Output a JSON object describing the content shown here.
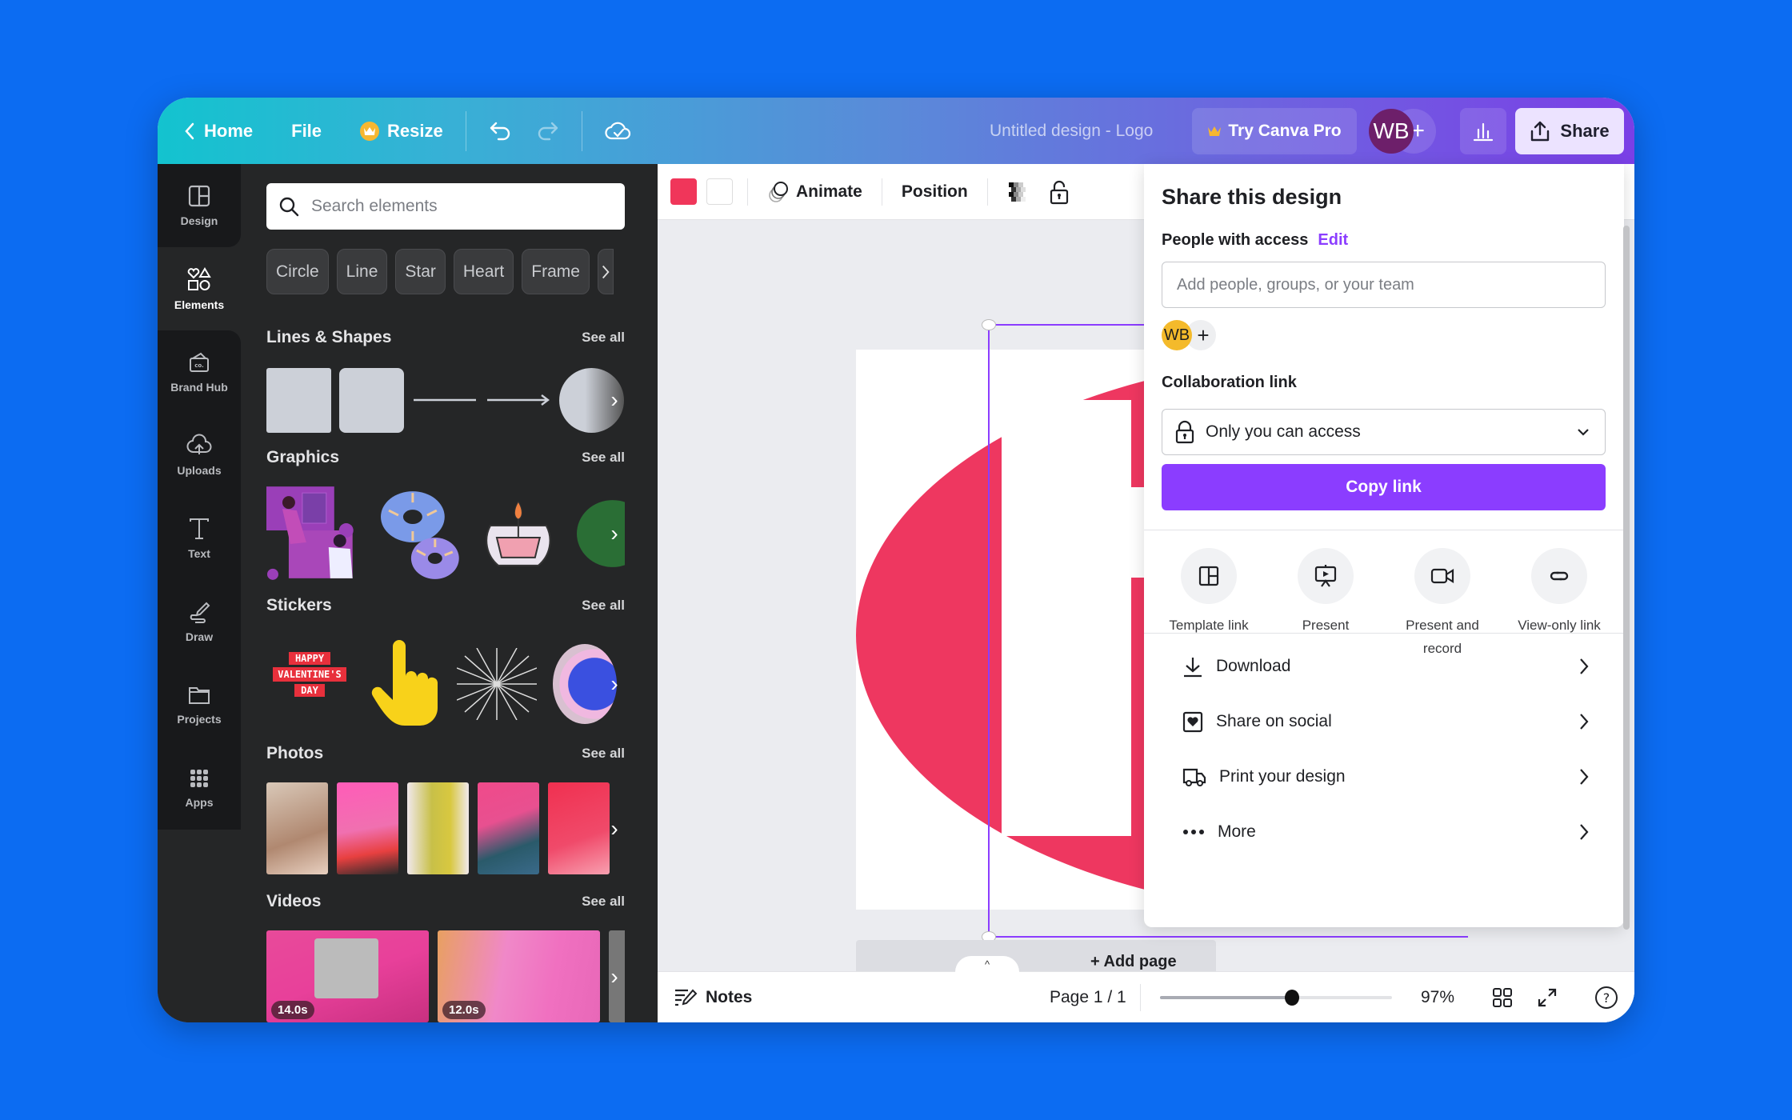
{
  "topbar": {
    "home_label": "Home",
    "file_label": "File",
    "resize_label": "Resize",
    "document_title": "Untitled design - Logo",
    "try_pro_label": "Try Canva Pro",
    "user_initials": "WB",
    "add_collaborator": "+",
    "share_label": "Share"
  },
  "rail": {
    "items": [
      {
        "label": "Design",
        "icon": "layout-icon"
      },
      {
        "label": "Elements",
        "icon": "shapes-icon",
        "active": true
      },
      {
        "label": "Brand Hub",
        "icon": "brand-hub-icon"
      },
      {
        "label": "Uploads",
        "icon": "cloud-upload-icon"
      },
      {
        "label": "Text",
        "icon": "text-icon"
      },
      {
        "label": "Draw",
        "icon": "draw-icon"
      },
      {
        "label": "Projects",
        "icon": "folder-icon"
      },
      {
        "label": "Apps",
        "icon": "apps-grid-icon"
      }
    ]
  },
  "panel": {
    "search_placeholder": "Search elements",
    "chips": [
      "Circle",
      "Line",
      "Star",
      "Heart",
      "Frame"
    ],
    "see_all": "See all",
    "sections": {
      "lines_shapes": "Lines & Shapes",
      "graphics": "Graphics",
      "stickers": "Stickers",
      "photos": "Photos",
      "videos": "Videos"
    },
    "sticker_text": [
      "HAPPY",
      "VALENTINE'S",
      "DAY"
    ],
    "video_durations": [
      "14.0s",
      "12.0s"
    ]
  },
  "context_toolbar": {
    "colors": [
      "#f0365a",
      "#ffffff"
    ],
    "animate_label": "Animate",
    "position_label": "Position"
  },
  "canvas": {
    "add_page_label": "+ Add page",
    "shape_color": "#ee3760"
  },
  "share_panel": {
    "title": "Share this design",
    "people_label": "People with access",
    "edit_label": "Edit",
    "add_people_placeholder": "Add people, groups, or your team",
    "member_initials": "WB",
    "collab_label": "Collaboration link",
    "access_value": "Only you can access",
    "copy_link_label": "Copy link",
    "actions": [
      {
        "label": "Template link",
        "icon": "template-icon"
      },
      {
        "label": "Present",
        "icon": "present-icon"
      },
      {
        "label": "Present and record",
        "icon": "video-camera-icon"
      },
      {
        "label": "View-only link",
        "icon": "link-icon"
      }
    ],
    "menu": [
      {
        "label": "Download",
        "icon": "download-icon"
      },
      {
        "label": "Share on social",
        "icon": "social-heart-icon"
      },
      {
        "label": "Print your design",
        "icon": "truck-icon"
      },
      {
        "label": "More",
        "icon": "more-dots-icon"
      }
    ],
    "accent_color": "#8b3dff"
  },
  "bottombar": {
    "notes_label": "Notes",
    "page_indicator": "Page 1 / 1",
    "zoom_percent": 97,
    "zoom_label": "97%",
    "zoom_slider_fraction": 0.57
  }
}
